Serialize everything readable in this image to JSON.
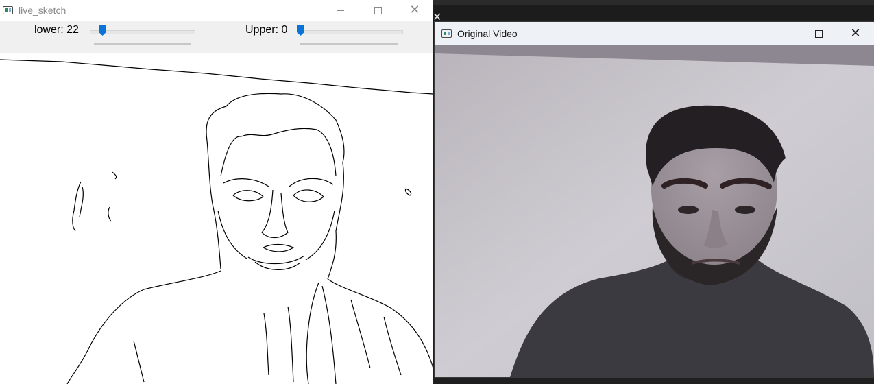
{
  "left_window": {
    "title": "live_sketch",
    "icon": "app-window-icon",
    "controls": [
      "minimize-icon",
      "maximize-icon",
      "close-icon"
    ],
    "trackbars": [
      {
        "label": "lower: 22",
        "value": 22
      },
      {
        "label": "Upper: 0",
        "value": 0
      }
    ]
  },
  "right_window": {
    "title": "Original Video",
    "icon": "app-window-icon",
    "controls": [
      "minimize-icon",
      "maximize-icon",
      "close-icon"
    ]
  }
}
